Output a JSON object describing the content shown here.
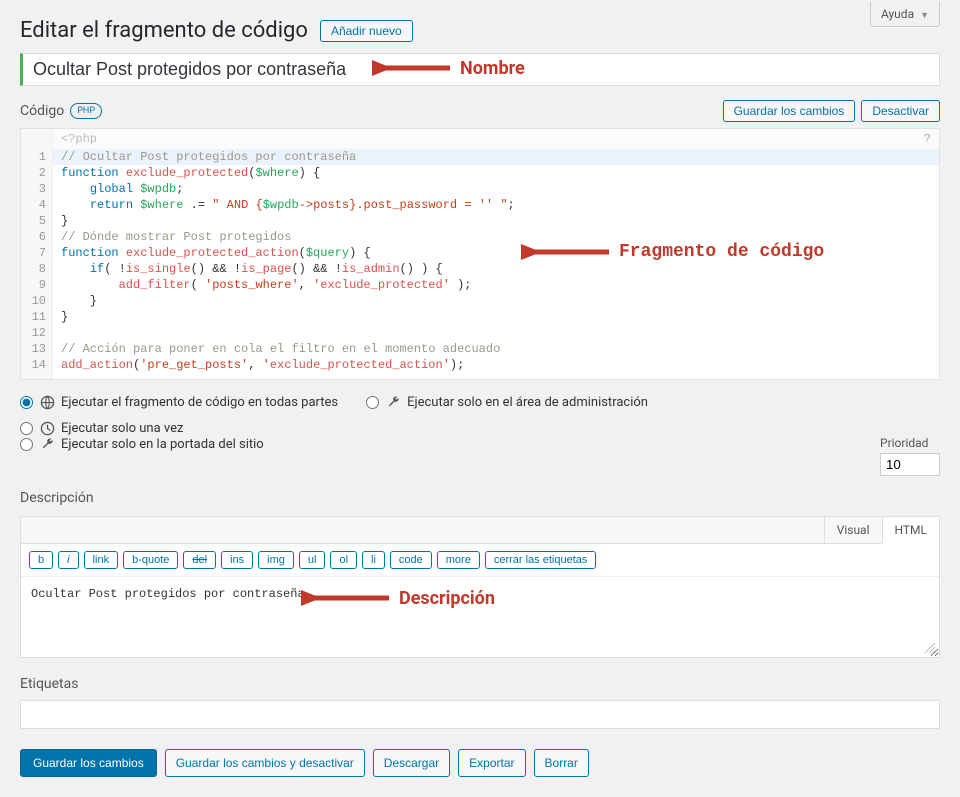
{
  "help": {
    "label": "Ayuda"
  },
  "heading": {
    "title": "Editar el fragmento de código",
    "add_new": "Añadir nuevo"
  },
  "title_field": {
    "value": "Ocultar Post protegidos por contraseña"
  },
  "annotations": {
    "name": "Nombre",
    "code": "Fragmento de código",
    "desc": "Descripción"
  },
  "code_section": {
    "label": "Código",
    "badge": "PHP",
    "save": "Guardar los cambios",
    "deactivate": "Desactivar",
    "open_tag": "<?php",
    "help_icon": "?",
    "lines": [
      "// Ocultar Post protegidos por contraseña",
      "function exclude_protected($where) {",
      "    global $wpdb;",
      "    return $where .= \" AND {$wpdb->posts}.post_password = '' \";",
      "}",
      "// Dónde mostrar Post protegidos",
      "function exclude_protected_action($query) {",
      "    if( !is_single() && !is_page() && !is_admin() ) {",
      "        add_filter( 'posts_where', 'exclude_protected' );",
      "    }",
      "}",
      "",
      "// Acción para poner en cola el filtro en el momento adecuado",
      "add_action('pre_get_posts', 'exclude_protected_action');"
    ]
  },
  "scope": {
    "everywhere": "Ejecutar el fragmento de código en todas partes",
    "once": "Ejecutar solo una vez",
    "admin": "Ejecutar solo en el área de administración",
    "front": "Ejecutar solo en la portada del sitio",
    "selected": "everywhere"
  },
  "priority": {
    "label": "Prioridad",
    "value": "10"
  },
  "description": {
    "heading": "Descripción",
    "tabs": {
      "visual": "Visual",
      "html": "HTML",
      "active": "html"
    },
    "toolbar": {
      "b": "b",
      "i": "i",
      "link": "link",
      "bquote": "b-quote",
      "del": "del",
      "ins": "ins",
      "img": "img",
      "ul": "ul",
      "ol": "ol",
      "li": "li",
      "code": "code",
      "more": "more",
      "close": "cerrar las etiquetas"
    },
    "value": "Ocultar Post protegidos por contraseña"
  },
  "tags": {
    "heading": "Etiquetas",
    "value": ""
  },
  "footer": {
    "save": "Guardar los cambios",
    "save_deact": "Guardar los cambios y desactivar",
    "download": "Descargar",
    "export": "Exportar",
    "delete": "Borrar"
  }
}
